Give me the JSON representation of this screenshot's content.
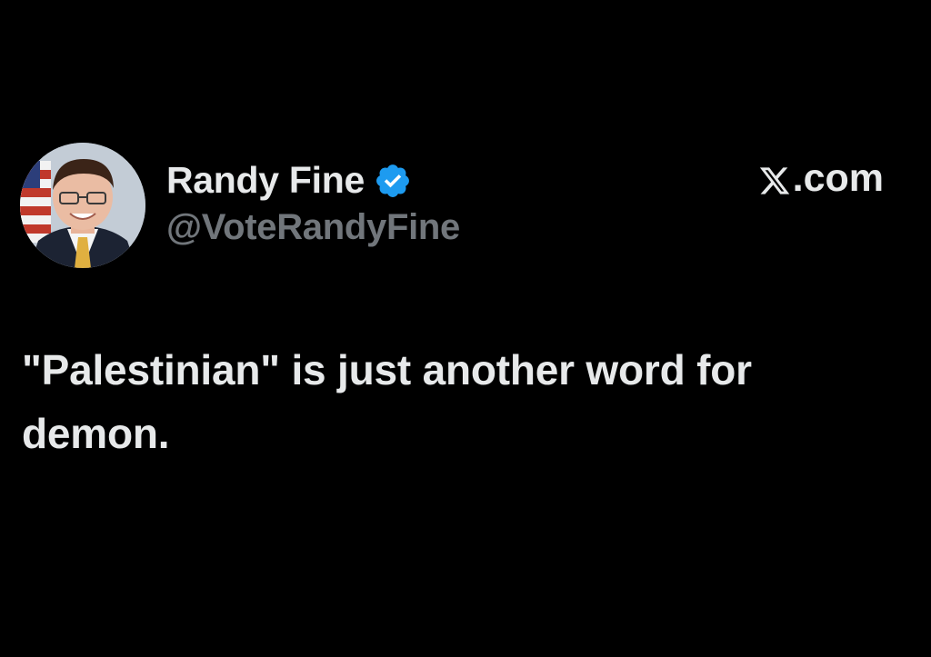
{
  "author": {
    "display_name": "Randy Fine",
    "handle": "@VoteRandyFine",
    "verified": true,
    "verified_icon": "verified-badge-icon",
    "avatar_icon": "profile-photo"
  },
  "site": {
    "label": ".com",
    "logo_icon": "x-logo-icon"
  },
  "tweet": {
    "text": "\"Palestinian\" is just another word for demon."
  },
  "colors": {
    "background": "#000000",
    "primary_text": "#e7e9ea",
    "secondary_text": "#71767b",
    "verified_blue": "#1d9bf0"
  }
}
